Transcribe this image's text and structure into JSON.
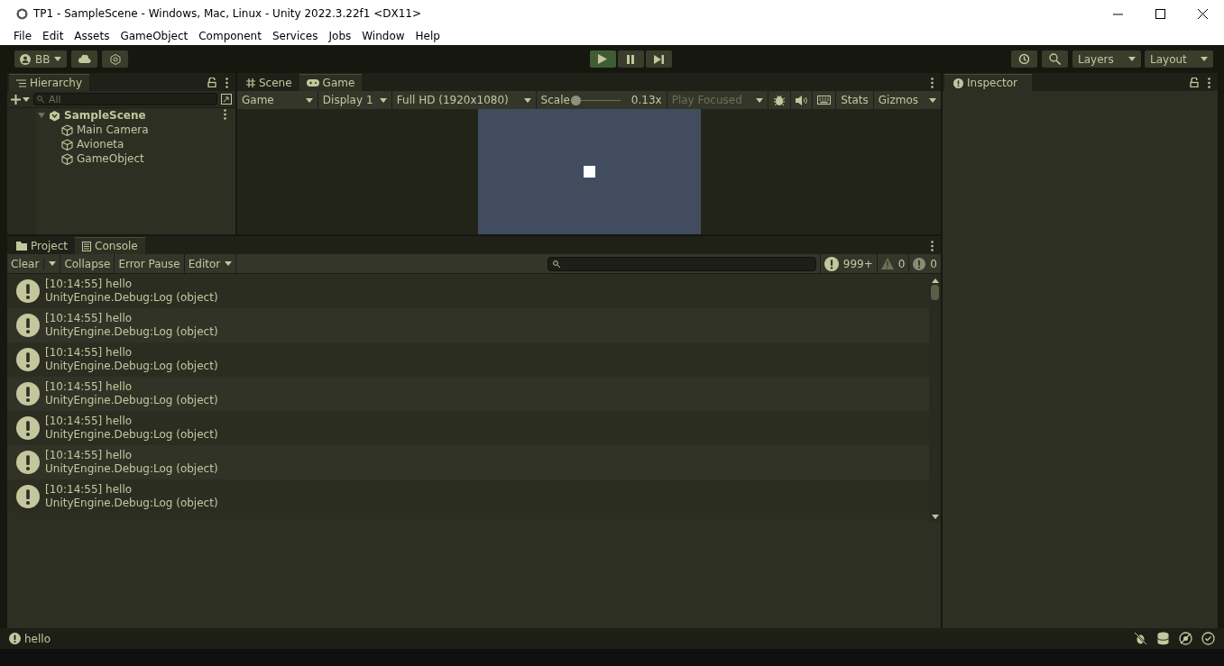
{
  "window": {
    "title": "TP1 - SampleScene - Windows, Mac, Linux - Unity 2022.3.22f1 <DX11>"
  },
  "menu": [
    "File",
    "Edit",
    "Assets",
    "GameObject",
    "Component",
    "Services",
    "Jobs",
    "Window",
    "Help"
  ],
  "toolbar": {
    "account": "BB",
    "layers": "Layers",
    "layout": "Layout"
  },
  "hierarchy": {
    "title": "Hierarchy",
    "search_placeholder": "All",
    "scene": {
      "name": "SampleScene",
      "expanded": true,
      "children": [
        {
          "name": "Main Camera"
        },
        {
          "name": "Avioneta"
        },
        {
          "name": "GameObject"
        }
      ]
    }
  },
  "game_view": {
    "tabs": [
      {
        "label": "Scene",
        "kind": "grid",
        "selected": false
      },
      {
        "label": "Game",
        "kind": "gamepad",
        "selected": true
      }
    ],
    "controls": {
      "mode": "Game",
      "display": "Display 1",
      "resolution": "Full HD (1920x1080)",
      "scale_label": "Scale",
      "scale": {
        "level": 0
      },
      "scale_value": "0.13x",
      "play_focused": "Play Focused",
      "stats": "Stats",
      "gizmos": "Gizmos"
    }
  },
  "console": {
    "tabs": [
      {
        "label": "Project",
        "kind": "folder",
        "selected": false
      },
      {
        "label": "Console",
        "kind": "list",
        "selected": true
      }
    ],
    "buttons": [
      "Clear",
      "Collapse",
      "Error Pause",
      "Editor"
    ],
    "counts": [
      {
        "kind": "log",
        "value": "999+"
      },
      {
        "kind": "warning",
        "value": "0"
      },
      {
        "kind": "error",
        "value": "0"
      }
    ],
    "entries": [
      {
        "message": "[10:14:55] hello",
        "source": "UnityEngine.Debug:Log (object)"
      },
      {
        "message": "[10:14:55] hello",
        "source": "UnityEngine.Debug:Log (object)"
      },
      {
        "message": "[10:14:55] hello",
        "source": "UnityEngine.Debug:Log (object)"
      },
      {
        "message": "[10:14:55] hello",
        "source": "UnityEngine.Debug:Log (object)"
      },
      {
        "message": "[10:14:55] hello",
        "source": "UnityEngine.Debug:Log (object)"
      },
      {
        "message": "[10:14:55] hello",
        "source": "UnityEngine.Debug:Log (object)"
      },
      {
        "message": "[10:14:55] hello",
        "source": "UnityEngine.Debug:Log (object)"
      }
    ]
  },
  "inspector": {
    "title": "Inspector"
  },
  "status_bar": {
    "message": "hello"
  }
}
